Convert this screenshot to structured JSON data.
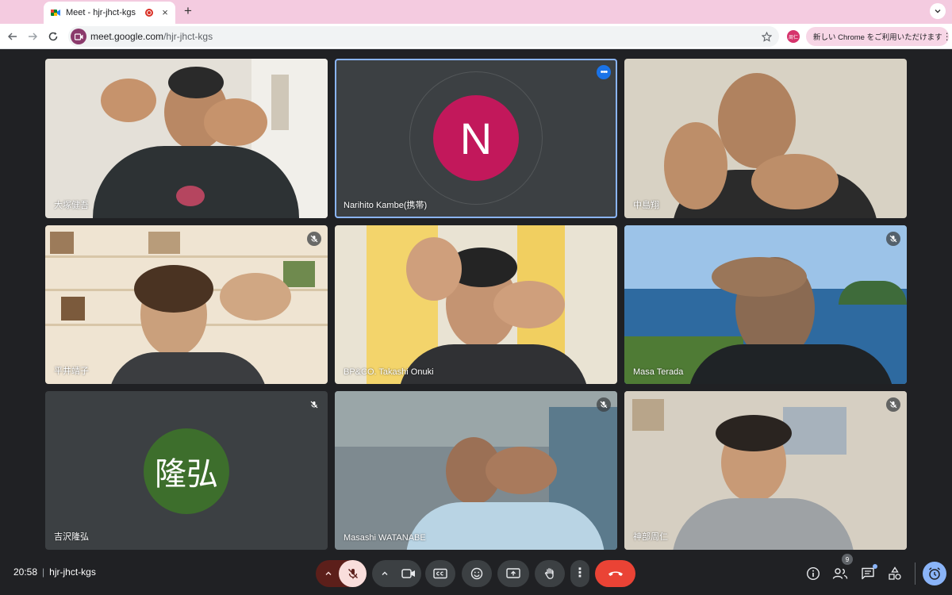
{
  "browser": {
    "tab_title": "Meet - hjr-jhct-kgs",
    "tab_close": "×",
    "new_tab": "+",
    "url_host": "meet.google.com",
    "url_path": "/hjr-jhct-kgs",
    "profile_initial": "周仁",
    "update_label": "新しい Chrome をご利用いただけます",
    "menu_glyph": "⋮"
  },
  "participants": [
    {
      "name": "大塚健吾",
      "muted": false
    },
    {
      "name": "Narihito Kambe(携帯)",
      "muted": false,
      "avatar_letter": "N",
      "active": true
    },
    {
      "name": "中島翔",
      "muted": false
    },
    {
      "name": "平井靖子",
      "muted": true
    },
    {
      "name": "BP&CO. Takashi Onuki",
      "muted": false
    },
    {
      "name": "Masa Terada",
      "muted": true
    },
    {
      "name": "吉沢隆弘",
      "muted": true,
      "avatar_letter": "隆弘"
    },
    {
      "name": "Masashi WATANABE",
      "muted": true
    },
    {
      "name": "神部周仁",
      "muted": true
    }
  ],
  "meeting": {
    "time": "20:58",
    "separator": "|",
    "code": "hjr-jhct-kgs"
  },
  "controls": {
    "people_count": "9",
    "more_glyph": "⋮",
    "caret_glyph": "^"
  },
  "colors": {
    "accent": "#8ab4f8",
    "end_call": "#ea4335",
    "mic_off_bg": "#f9dedc",
    "avatar_n": "#c2185b",
    "avatar_kanji": "#3d6e2c"
  }
}
